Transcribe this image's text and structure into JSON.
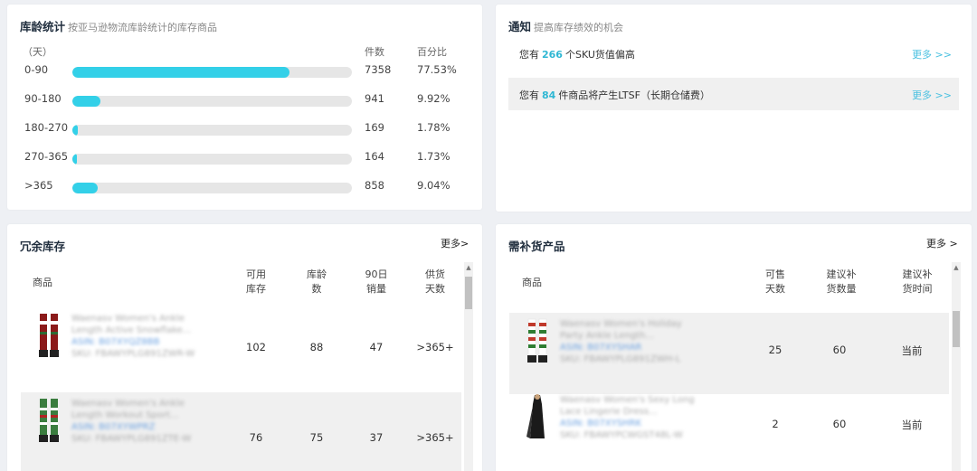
{
  "inventory_age": {
    "title": "库龄统计",
    "subtitle": "按亚马逊物流库龄统计的库存商品",
    "col_range": "（天）",
    "col_count": "件数",
    "col_pct": "百分比",
    "rows": [
      {
        "range": "0-90",
        "count": "7358",
        "pct": "77.53%",
        "fraction": 0.7753
      },
      {
        "range": "90-180",
        "count": "941",
        "pct": "9.92%",
        "fraction": 0.0992
      },
      {
        "range": "180-270",
        "count": "169",
        "pct": "1.78%",
        "fraction": 0.0178
      },
      {
        "range": "270-365",
        "count": "164",
        "pct": "1.73%",
        "fraction": 0.0173
      },
      {
        "range": ">365",
        "count": "858",
        "pct": "9.04%",
        "fraction": 0.0904
      }
    ],
    "bar_color": "#33d0e8"
  },
  "notice": {
    "title": "通知",
    "subtitle": "提高库存绩效的机会",
    "items": [
      {
        "prefix": "您有",
        "num": "266",
        "suffix": "个SKU货值偏高",
        "more": "更多 >>"
      },
      {
        "prefix": "您有",
        "num": "84",
        "suffix": "件商品将产生LTSF（长期仓储费）",
        "more": "更多 >>"
      }
    ]
  },
  "excess": {
    "title": "冗余库存",
    "more": "更多>",
    "headers": {
      "product": "商品",
      "available": "可用\n库存",
      "age": "库龄\n数",
      "sales": "90日\n销量",
      "supply": "供货\n天数"
    },
    "rows": [
      {
        "name": "Waenasv Women's Ankle Length Active Snowflake...",
        "asin": "ASIN: B07XYQZ8BB",
        "sku": "SKU: FBAWYPLG891ZWR-W",
        "available": "102",
        "age": "88",
        "sales": "47",
        "supply": ">365+"
      },
      {
        "name": "Waenasv Women's Ankle Length Workout Sport...",
        "asin": "ASIN: B07XYWPRZ",
        "sku": "SKU: FBAWYPLG891ZTE-W",
        "available": "76",
        "age": "75",
        "sales": "37",
        "supply": ">365+"
      }
    ]
  },
  "restock": {
    "title": "需补货产品",
    "more": "更多 >",
    "headers": {
      "product": "商品",
      "sellable": "可售\n天数",
      "qty": "建议补\n货数量",
      "time": "建议补\n货时间"
    },
    "rows": [
      {
        "name": "Waenasv Women's Holiday Party Ankle Length...",
        "asin": "ASIN: B07XYSHAR",
        "sku": "SKU: FBAWYPLG891ZWH-L",
        "sellable": "25",
        "qty": "60",
        "time": "当前"
      },
      {
        "name": "Waenasv Women's Sexy Long Lace Lingerie Dress...",
        "asin": "ASIN: B07XYSHRK",
        "sku": "SKU: FBAWYPCWGST48L-W",
        "sellable": "2",
        "qty": "60",
        "time": "当前"
      }
    ]
  }
}
